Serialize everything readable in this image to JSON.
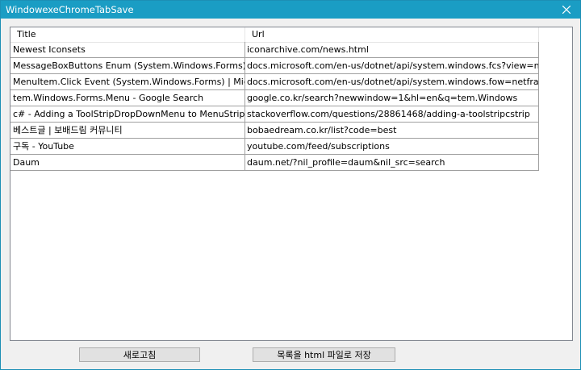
{
  "window": {
    "title": "WindowexeChromeTabSave"
  },
  "table": {
    "headers": [
      "Title",
      "Url"
    ],
    "rows": [
      {
        "title": "Newest Iconsets",
        "url": "iconarchive.com/news.html"
      },
      {
        "title": "MessageBoxButtons Enum (System.Windows.Forms) ...",
        "url": "docs.microsoft.com/en-us/dotnet/api/system.windows.fcs?view=netfr..."
      },
      {
        "title": "MenuItem.Click Event (System.Windows.Forms) | Micr...",
        "url": "docs.microsoft.com/en-us/dotnet/api/system.windows.fow=netframe..."
      },
      {
        "title": "tem.Windows.Forms.Menu - Google Search",
        "url": "google.co.kr/search?newwindow=1&hl=en&q=tem.Windows"
      },
      {
        "title": "c# - Adding a ToolStripDropDownMenu to MenuStrip - ...",
        "url": "stackoverflow.com/questions/28861468/adding-a-toolstripcstrip"
      },
      {
        "title": "베스트글 | 보배드림 커뮤니티",
        "url": "bobaedream.co.kr/list?code=best"
      },
      {
        "title": "구독 - YouTube",
        "url": "youtube.com/feed/subscriptions"
      },
      {
        "title": "Daum",
        "url": "daum.net/?nil_profile=daum&nil_src=search"
      }
    ]
  },
  "buttons": {
    "refresh": "새로고침",
    "save_html": "목록을 html 파일로 저장"
  }
}
